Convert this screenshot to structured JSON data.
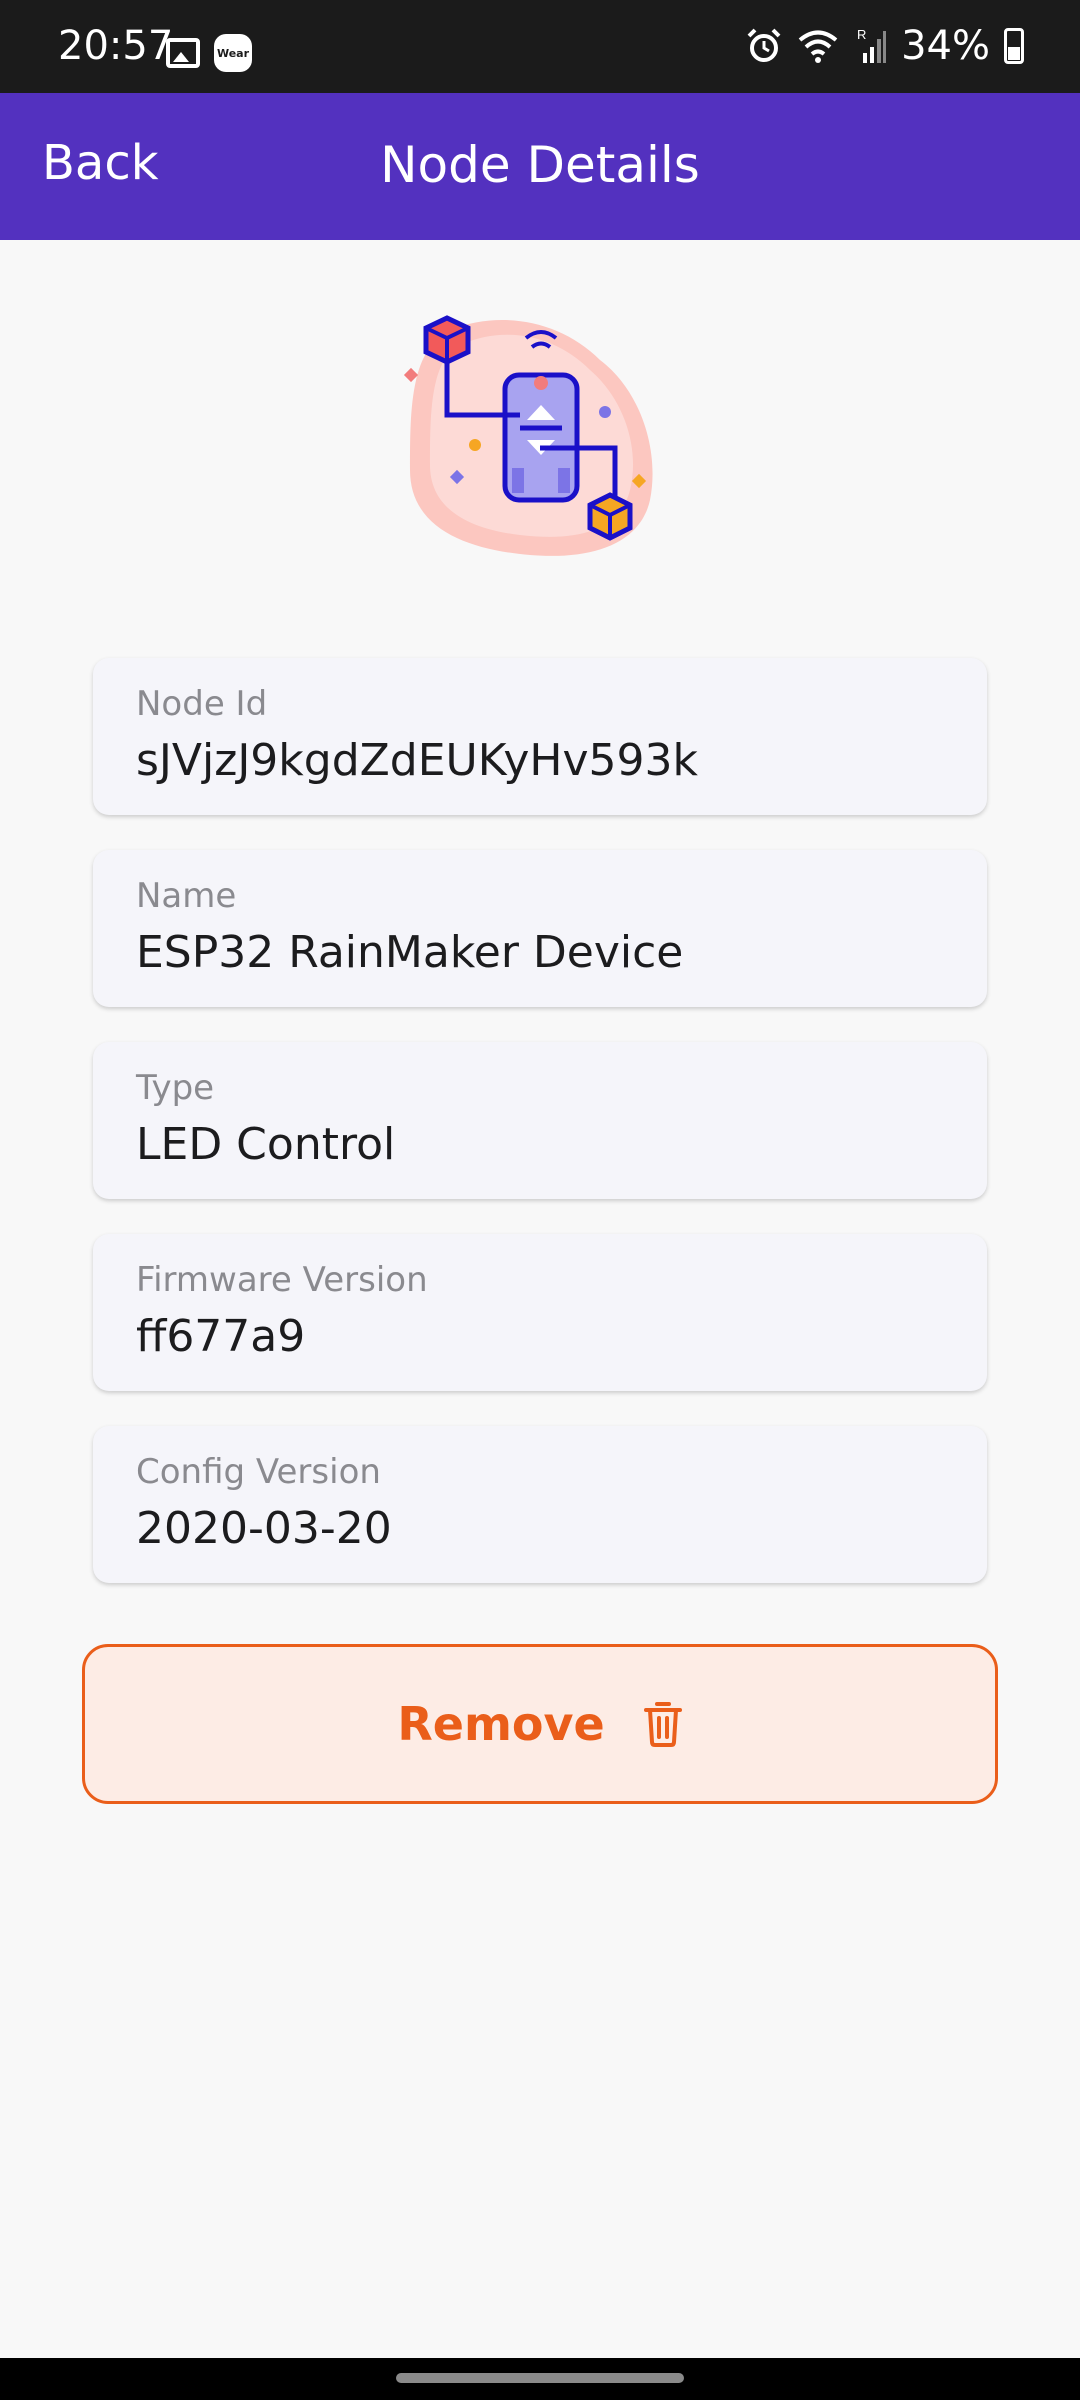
{
  "status_bar": {
    "time": "20:57",
    "battery": "34%",
    "icons": [
      "image-icon",
      "wear-icon",
      "alarm-icon",
      "wifi-icon",
      "signal-icon",
      "battery-icon"
    ],
    "wear_label": "Wear"
  },
  "app_bar": {
    "back_label": "Back",
    "title": "Node Details",
    "color": "#5331bf"
  },
  "details": [
    {
      "label": "Node Id",
      "value": "sJVjzJ9kgdZdEUKyHv593k"
    },
    {
      "label": "Name",
      "value": "ESP32 RainMaker Device"
    },
    {
      "label": "Type",
      "value": "LED Control"
    },
    {
      "label": "Firmware Version",
      "value": "ff677a9"
    },
    {
      "label": "Config Version",
      "value": "2020-03-20"
    }
  ],
  "remove_button": {
    "label": "Remove",
    "icon": "trash-icon",
    "color": "#ea5e1a"
  }
}
